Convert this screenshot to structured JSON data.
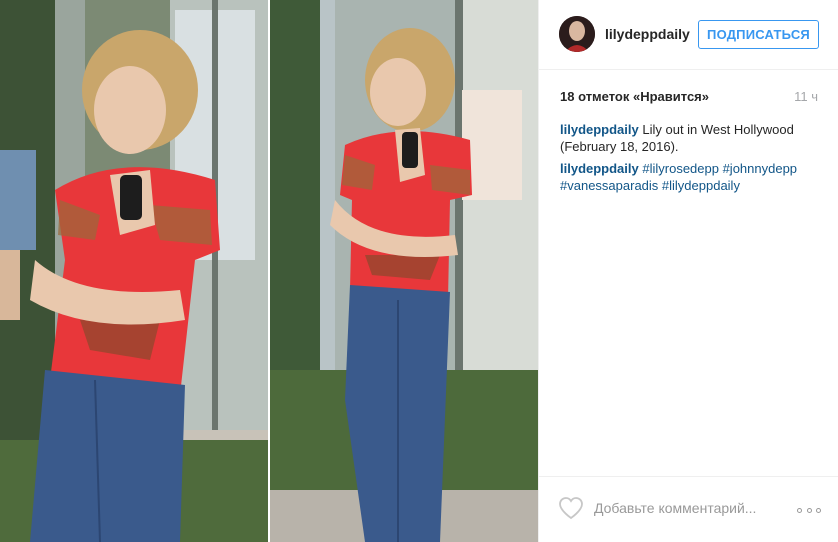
{
  "post": {
    "image_alt": "Two photos of a young woman in a red patterned top and high-waisted blue jeans on a street",
    "colors": {
      "top": "#e8373a",
      "jeans": "#3a5a8c",
      "hair": "#c9a66b"
    }
  },
  "header": {
    "username": "lilydeppdaily",
    "follow_label": "ПОДПИСАТЬСЯ"
  },
  "meta": {
    "likes": "18 отметок «Нравится»",
    "time": "11 ч"
  },
  "caption": {
    "username": "lilydeppdaily",
    "text": " Lily out in West Hollywood (February 18, 2016)."
  },
  "hashtags": {
    "username": "lilydeppdaily",
    "tags": " #lilyrosedepp #johnnydepp #vanessaparadis #lilydeppdaily"
  },
  "comment": {
    "placeholder": "Добавьте комментарий..."
  },
  "colors": {
    "accent": "#3897f0",
    "link": "#125688",
    "text": "#262626",
    "muted": "#a5a7aa"
  }
}
